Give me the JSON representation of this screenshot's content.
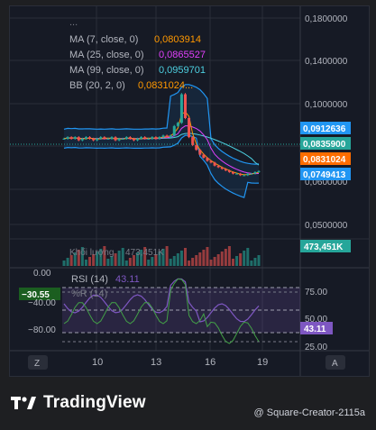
{
  "indicators": {
    "collapsed": "...",
    "ma7": {
      "label": "MA (7, close, 0)",
      "value": "0,0803914",
      "color": "#ff9800"
    },
    "ma25": {
      "label": "MA (25, close, 0)",
      "value": "0,0865527",
      "color": "#e040fb"
    },
    "ma99": {
      "label": "MA (99, close, 0)",
      "value": "0,0959701",
      "color": "#4dd0e1"
    },
    "bb": {
      "label": "BB (20, 2, 0)",
      "value": "0,0831024...",
      "color": "#ff9800"
    }
  },
  "volume": {
    "label": "Khối lượng",
    "value": "473,451K",
    "badge": "473,451K"
  },
  "rsi": {
    "label": "RSI (14)",
    "value": "43.11",
    "badge": "43.11"
  },
  "wr": {
    "label": "%R (14)",
    "badge": "−30.55"
  },
  "price_badges": [
    "0,0912636",
    "0,0835900",
    "0,0831024",
    "0,0749413"
  ],
  "price_axis": [
    "0,1800000",
    "0,1400000",
    "0,1000000",
    "0,0600000",
    "0,0500000"
  ],
  "rsi_axis": [
    "75.00",
    "50.00",
    "25.00"
  ],
  "wr_axis": [
    "0.00",
    "−40.00",
    "−80.00"
  ],
  "time_axis": [
    "10",
    "13",
    "16",
    "19"
  ],
  "corner_left": "Z",
  "corner_right": "A",
  "brand": {
    "name": "TradingView"
  },
  "watermark": "@ Square-Creator-2115a",
  "colors": {
    "up": "#26a69a",
    "down": "#ef5350",
    "bb": "#2196f3",
    "rsi": "#7e57c2",
    "wr": "#43a047"
  },
  "chart_data": {
    "type": "candlestick",
    "x_ticks": [
      "10",
      "13",
      "16",
      "19"
    ],
    "ylim": [
      0.05,
      0.18
    ],
    "price_close_series": [
      0.104,
      0.105,
      0.104,
      0.105,
      0.103,
      0.104,
      0.105,
      0.104,
      0.103,
      0.104,
      0.105,
      0.104,
      0.104,
      0.105,
      0.103,
      0.104,
      0.104,
      0.105,
      0.104,
      0.103,
      0.104,
      0.105,
      0.104,
      0.104,
      0.105,
      0.104,
      0.105,
      0.106,
      0.105,
      0.106,
      0.112,
      0.114,
      0.132,
      0.117,
      0.105,
      0.1,
      0.097,
      0.094,
      0.092,
      0.09,
      0.089,
      0.087,
      0.086,
      0.085,
      0.084,
      0.083,
      0.082,
      0.082,
      0.081,
      0.081,
      0.082,
      0.082,
      0.083,
      0.0836
    ]
  }
}
